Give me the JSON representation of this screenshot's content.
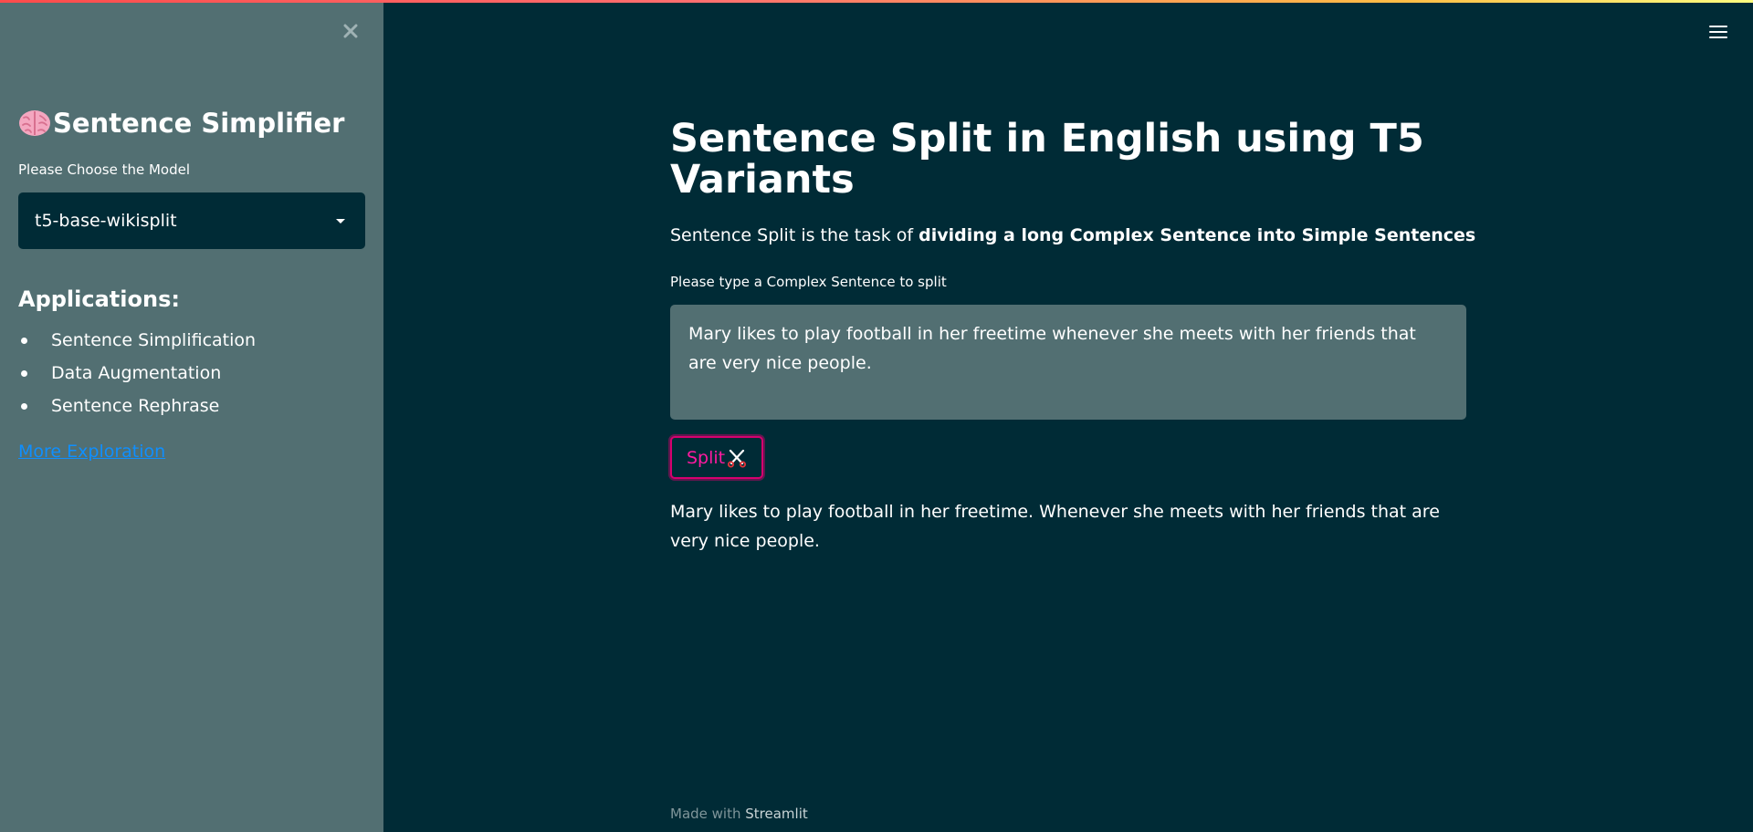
{
  "colors": {
    "main_background": "#002b36",
    "sidebar_background": "#526f72",
    "accent": "#d6006f",
    "link": "#0f8fff"
  },
  "sidebar": {
    "close_icon": "close-icon",
    "title": "Sentence Simplifier",
    "title_icon": "brain-icon",
    "model_label": "Please Choose the Model",
    "model_selected": "t5-base-wikisplit",
    "applications_heading": "Applications:",
    "applications": [
      "Sentence Simplification",
      "Data Augmentation",
      "Sentence Rephrase"
    ],
    "more_link": "More Exploration"
  },
  "header": {
    "menu_icon": "hamburger-menu-icon"
  },
  "main": {
    "title": "Sentence Split in English using T5 Variants",
    "intro_prefix": "Sentence Split is the task of ",
    "intro_bold": "dividing a long Complex Sentence into Simple Sentences",
    "input_label": "Please type a Complex Sentence to split",
    "input_value": "Mary likes to play football in her freetime whenever she meets with her friends that are very nice people.",
    "split_button_label": "Split",
    "split_button_icon": "scissors-icon",
    "result": "Mary likes to play football in her freetime. Whenever she meets with her friends that are very nice people."
  },
  "footer": {
    "prefix": "Made with ",
    "link": "Streamlit"
  }
}
